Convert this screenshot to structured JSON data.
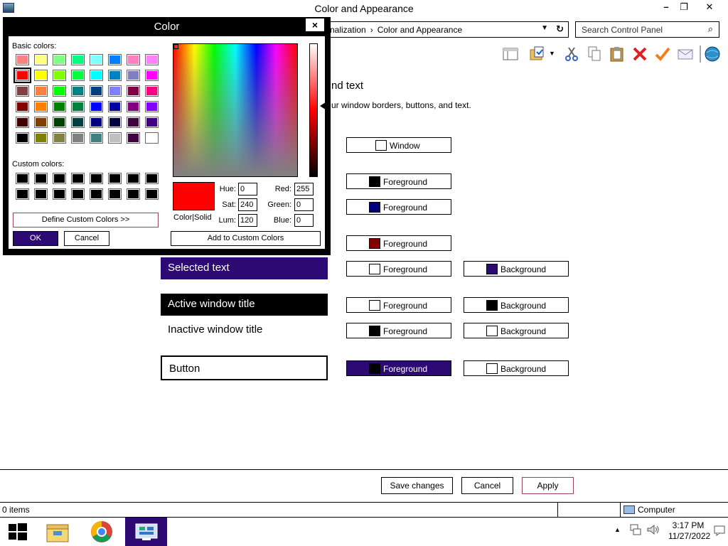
{
  "window": {
    "title": "Color and Appearance"
  },
  "address": {
    "crumbs": [
      "nalization",
      "›",
      "Color and Appearance"
    ]
  },
  "search": {
    "placeholder": "Search Control Panel"
  },
  "page": {
    "heading": "nd text",
    "description": "ur window borders, buttons, and text."
  },
  "rows": {
    "window": {
      "fg_label": "Window",
      "fg_color": "#ffffff"
    },
    "row2": {
      "fg_label": "Foreground",
      "fg_color": "#000000"
    },
    "row3": {
      "fg_label": "Foreground",
      "fg_color": "#000080"
    },
    "row4": {
      "fg_label": "Foreground",
      "fg_color": "#800000"
    },
    "selected": {
      "sample": "Selected text",
      "sample_bg": "#2d0a73",
      "fg_label": "Foreground",
      "fg_color": "#ffffff",
      "bg_label": "Background",
      "bg_color": "#2d0a73"
    },
    "active": {
      "sample": "Active window title",
      "sample_bg": "#000000",
      "fg_label": "Foreground",
      "fg_color": "#ffffff",
      "bg_label": "Background",
      "bg_color": "#000000"
    },
    "inactive": {
      "sample": "Inactive window title",
      "fg_label": "Foreground",
      "fg_color": "#000000",
      "bg_label": "Background",
      "bg_color": "#ffffff"
    },
    "button": {
      "sample": "Button",
      "fg_label": "Foreground",
      "fg_color": "#000000",
      "fg_button_bg": "#2d0a73",
      "bg_label": "Background",
      "bg_color": "#ffffff"
    }
  },
  "footer": {
    "save": "Save changes",
    "cancel": "Cancel",
    "apply": "Apply"
  },
  "statusbar": {
    "items": "0 items",
    "location": "Computer"
  },
  "taskbar": {
    "time": "3:17 PM",
    "date": "11/27/2022"
  },
  "dialog": {
    "title": "Color",
    "close": "×",
    "basic_label": "Basic colors:",
    "custom_label": "Custom colors:",
    "define_custom": "Define Custom Colors >>",
    "ok": "OK",
    "cancel": "Cancel",
    "add_custom": "Add to Custom Colors",
    "color_solid": "Color|Solid",
    "fields": {
      "hue_label": "Hue:",
      "hue": "0",
      "sat_label": "Sat:",
      "sat": "240",
      "lum_label": "Lum:",
      "lum": "120",
      "red_label": "Red:",
      "red": "255",
      "green_label": "Green:",
      "green": "0",
      "blue_label": "Blue:",
      "blue": "0"
    },
    "preview_color": "#ff0000",
    "basic_colors": [
      "#ff8080",
      "#ffff80",
      "#80ff80",
      "#00ff80",
      "#80ffff",
      "#0080ff",
      "#ff80c0",
      "#ff80ff",
      "#ff0000",
      "#ffff00",
      "#80ff00",
      "#00ff40",
      "#00ffff",
      "#0080c0",
      "#8080c0",
      "#ff00ff",
      "#804040",
      "#ff8040",
      "#00ff00",
      "#008080",
      "#004080",
      "#8080ff",
      "#800040",
      "#ff0080",
      "#800000",
      "#ff8000",
      "#008000",
      "#008040",
      "#0000ff",
      "#0000a0",
      "#800080",
      "#8000ff",
      "#400000",
      "#804000",
      "#004000",
      "#004040",
      "#000080",
      "#000040",
      "#400040",
      "#400080",
      "#000000",
      "#808000",
      "#808040",
      "#808080",
      "#408080",
      "#c0c0c0",
      "#400040",
      "#ffffff"
    ],
    "custom_colors": [
      "#000000",
      "#000000",
      "#000000",
      "#000000",
      "#000000",
      "#000000",
      "#000000",
      "#000000",
      "#000000",
      "#000000",
      "#000000",
      "#000000",
      "#000000",
      "#000000",
      "#000000",
      "#000000"
    ]
  }
}
